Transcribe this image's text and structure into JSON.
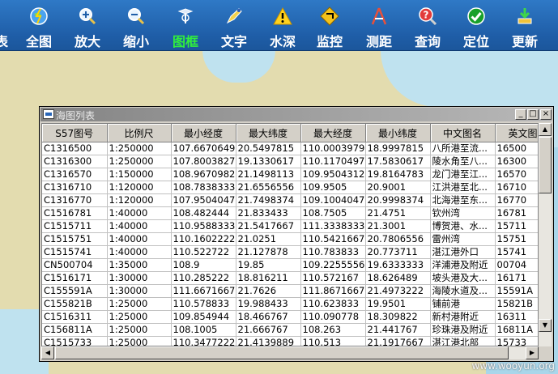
{
  "toolbar": {
    "left_partial_label": "表",
    "buttons": [
      {
        "label": "全图",
        "icon": "globe-icon"
      },
      {
        "label": "放大",
        "icon": "zoom-in-icon"
      },
      {
        "label": "缩小",
        "icon": "zoom-out-icon"
      },
      {
        "label": "图框",
        "icon": "chart-frame-icon",
        "active": true
      },
      {
        "label": "文字",
        "icon": "text-pen-icon"
      },
      {
        "label": "水深",
        "icon": "warning-depth-icon"
      },
      {
        "label": "监控",
        "icon": "monitor-diamond-icon"
      },
      {
        "label": "测距",
        "icon": "ruler-compass-icon"
      },
      {
        "label": "查询",
        "icon": "query-magnifier-icon"
      },
      {
        "label": "定位",
        "icon": "locate-check-icon"
      },
      {
        "label": "更新",
        "icon": "update-download-icon"
      }
    ],
    "colors": {
      "bar": "#1f5ea8",
      "label": "#ffffff",
      "active_label": "#31ef3c"
    }
  },
  "window": {
    "title": "海图列表",
    "buttons": {
      "minimize": "_",
      "maximize": "□",
      "close": "×"
    },
    "columns": [
      "S57图号",
      "比例尺",
      "最小经度",
      "最大纬度",
      "最大经度",
      "最小纬度",
      "中文图名",
      "英文图名"
    ],
    "rows": [
      [
        "C1316500",
        "1:250000",
        "107.6670649",
        "20.5497815",
        "110.0003979",
        "18.9997815",
        "八所港至流...",
        "16500"
      ],
      [
        "C1316300",
        "1:250000",
        "107.8003827",
        "19.1330617",
        "110.1170497",
        "17.5830617",
        "陵水角至八...",
        "16300"
      ],
      [
        "C1316570",
        "1:150000",
        "108.9670982",
        "21.1498113",
        "109.9504312",
        "19.8164783",
        "龙门港至江...",
        "16570"
      ],
      [
        "C1316710",
        "1:120000",
        "108.7838333",
        "21.6556556",
        "109.9505",
        "20.9001",
        "江洪港至北...",
        "16710"
      ],
      [
        "C1316770",
        "1:120000",
        "107.9504047",
        "21.7498374",
        "109.1004047",
        "20.9998374",
        "北海港至东...",
        "16770"
      ],
      [
        "C1516781",
        "1:40000",
        "108.482444",
        "21.833433",
        "108.7505",
        "21.4751",
        "钦州湾",
        "16781"
      ],
      [
        "C1515711",
        "1:40000",
        "110.9588333",
        "21.5417667",
        "111.3338333",
        "21.3001",
        "博贺港、水...",
        "15711"
      ],
      [
        "C1515751",
        "1:40000",
        "110.1602222",
        "21.0251",
        "110.5421667",
        "20.7806556",
        "雷州湾",
        "15751"
      ],
      [
        "C1515741",
        "1:40000",
        "110.522722",
        "21.127878",
        "110.783833",
        "20.773711",
        "湛江港外口",
        "15741"
      ],
      [
        "CN500704",
        "1:35000",
        "108.9",
        "19.85",
        "109.2255556",
        "19.6333333",
        "洋浦港及附近",
        "00704"
      ],
      [
        "C1516171",
        "1:30000",
        "110.285222",
        "18.816211",
        "110.572167",
        "18.626489",
        "坡头港及大...",
        "16171"
      ],
      [
        "C155591A",
        "1:30000",
        "111.6671667",
        "21.7626",
        "111.8671667",
        "21.4973222",
        "海陵水道及...",
        "15591A"
      ],
      [
        "C155821B",
        "1:25000",
        "110.578833",
        "19.988433",
        "110.623833",
        "19.9501",
        "铺前港",
        "15821B"
      ],
      [
        "C1516311",
        "1:25000",
        "109.854944",
        "18.466767",
        "110.090778",
        "18.309822",
        "新村港附近",
        "16311"
      ],
      [
        "C156811A",
        "1:25000",
        "108.1005",
        "21.666767",
        "108.263",
        "21.441767",
        "珍珠港及附近",
        "16811A"
      ],
      [
        "C1515733",
        "1:25000",
        "110.3477222",
        "21.4139889",
        "110.513",
        "21.1917667",
        "湛江港北部",
        "15733"
      ]
    ]
  },
  "watermark": "www.wooyun.org"
}
